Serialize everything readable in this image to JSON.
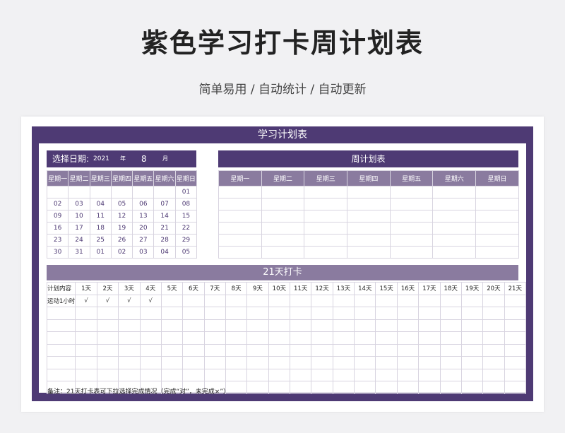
{
  "header": {
    "title": "紫色学习打卡周计划表",
    "subtitle": "简单易用 / 自动统计 / 自动更新"
  },
  "sheet": {
    "title": "学习计划表",
    "date_label": "选择日期:",
    "year": "2021",
    "year_unit": "年",
    "month": "8",
    "month_unit": "月",
    "weekdays": [
      "星期一",
      "星期二",
      "星期三",
      "星期四",
      "星期五",
      "星期六",
      "星期日"
    ],
    "calendar_rows": [
      [
        "",
        "",
        "",
        "",
        "",
        "",
        "01"
      ],
      [
        "02",
        "03",
        "04",
        "05",
        "06",
        "07",
        "08"
      ],
      [
        "09",
        "10",
        "11",
        "12",
        "13",
        "14",
        "15"
      ],
      [
        "16",
        "17",
        "18",
        "19",
        "20",
        "21",
        "22"
      ],
      [
        "23",
        "24",
        "25",
        "26",
        "27",
        "28",
        "29"
      ],
      [
        "30",
        "31",
        "01",
        "02",
        "03",
        "04",
        "05"
      ]
    ],
    "weekly_plan_title": "周计划表",
    "checkin_title": "21天打卡",
    "checkin_first_header": "计划内容",
    "days": [
      "1天",
      "2天",
      "3天",
      "4天",
      "5天",
      "6天",
      "7天",
      "8天",
      "9天",
      "10天",
      "11天",
      "12天",
      "13天",
      "14天",
      "15天",
      "16天",
      "17天",
      "18天",
      "19天",
      "20天",
      "21天"
    ],
    "checkin_rows": [
      {
        "item": "运动1小时",
        "marks": [
          "√",
          "√",
          "√",
          "√",
          "",
          "",
          "",
          "",
          "",
          "",
          "",
          "",
          "",
          "",
          "",
          "",
          "",
          "",
          "",
          "",
          ""
        ]
      }
    ],
    "empty_checkin_rows": 7,
    "note": "备注：21天打卡表可下拉选择完成情况（完成“对”，未完成×”）"
  },
  "colors": {
    "frame": "#4e3a74",
    "header_light": "#8a7b9f",
    "text_accent": "#4e3a74"
  }
}
